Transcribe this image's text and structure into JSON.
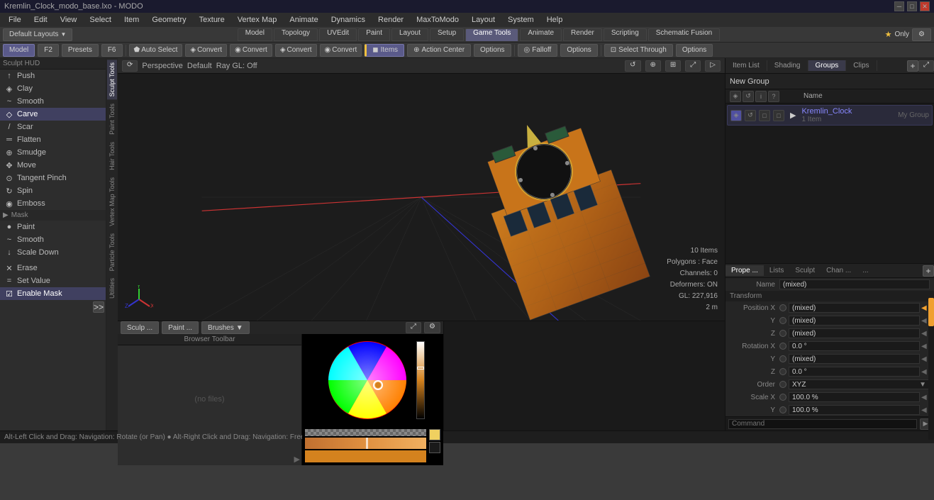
{
  "titlebar": {
    "title": "Kremlin_Clock_modo_base.lxo - MODO",
    "controls": [
      "minimize",
      "restore",
      "close"
    ]
  },
  "menubar": {
    "items": [
      "File",
      "Edit",
      "View",
      "Select",
      "Item",
      "Geometry",
      "Texture",
      "Vertex Map",
      "Animate",
      "Dynamics",
      "Render",
      "MaxToModo",
      "Layout",
      "System",
      "Help"
    ]
  },
  "toolbar1": {
    "layout_label": "Default Layouts",
    "tabs": [
      "Model",
      "Topology",
      "UVEdit",
      "Paint",
      "Layout",
      "Setup",
      "Game Tools",
      "Animate",
      "Render",
      "Scripting",
      "Schematic Fusion"
    ]
  },
  "toolbar2": {
    "mode_tabs": [
      "Model",
      "F2",
      "Presets",
      "F6"
    ],
    "auto_select": "Auto Select",
    "convert_buttons": [
      "Convert",
      "Convert",
      "Convert",
      "Convert"
    ],
    "items_btn": "Items",
    "action_center": "Action Center",
    "options1": "Options",
    "falloff": "Falloff",
    "options2": "Options",
    "select_through": "Select Through",
    "options3": "Options"
  },
  "toolbar3": {
    "perspective": "Perspective",
    "default": "Default",
    "ray_gl": "Ray GL: Off"
  },
  "sculpt_tools": {
    "section_title": "Sculpt HUD",
    "tools": [
      {
        "name": "Push",
        "icon": "↑"
      },
      {
        "name": "Clay",
        "icon": "◈"
      },
      {
        "name": "Smooth",
        "icon": "~"
      },
      {
        "name": "Carve",
        "icon": "◇"
      },
      {
        "name": "Scar",
        "icon": "/"
      },
      {
        "name": "Flatten",
        "icon": "═"
      },
      {
        "name": "Smudge",
        "icon": "⊕"
      },
      {
        "name": "Move",
        "icon": "✥"
      },
      {
        "name": "Tangent Pinch",
        "icon": "⊙"
      },
      {
        "name": "Spin",
        "icon": "↻"
      },
      {
        "name": "Emboss",
        "icon": "◉"
      }
    ],
    "mask_label": "Mask",
    "mask_tools": [
      {
        "name": "Paint",
        "icon": "●"
      },
      {
        "name": "Smooth",
        "icon": "~"
      },
      {
        "name": "Scale Down",
        "icon": "↓"
      }
    ],
    "bottom_tools": [
      {
        "name": "Erase",
        "icon": "✕"
      },
      {
        "name": "Set Value",
        "icon": "="
      },
      {
        "name": "Enable Mask",
        "icon": "☑",
        "active": true
      }
    ]
  },
  "vertical_tabs": {
    "items": [
      "Sculpt Tools",
      "Paint Tools",
      "Hair Tools",
      "Vertex Map Tools",
      "Particle Tools",
      "Utilities"
    ]
  },
  "viewport": {
    "perspective": "Perspective",
    "default_label": "Default",
    "ray_gl": "Ray GL: Off",
    "hud": {
      "items_count": "10 Items",
      "polygons": "Polygons : Face",
      "channels": "Channels: 0",
      "deformers": "Deformers: ON",
      "gl": "GL: 227,916",
      "distance": "2 m"
    }
  },
  "bottom_panels": {
    "left": {
      "tabs": [
        "Sculp ...",
        "Paint ...",
        "Brushes"
      ],
      "browser_toolbar": "Browser Toolbar",
      "no_files": "(no files)"
    }
  },
  "right_panel": {
    "tabs": [
      "Item List",
      "Shading",
      "Groups",
      "Clips"
    ],
    "active_tab": "Groups",
    "new_group": "New Group",
    "columns": [
      "Name"
    ],
    "group_item": {
      "name": "Kremlin_Clock",
      "sub": "1 Item",
      "tag": "My Group"
    }
  },
  "properties_panel": {
    "tabs": [
      "Prope ...",
      "Lists",
      "Sculpt",
      "Chan ...",
      "..."
    ],
    "name_label": "Name",
    "name_value": "(mixed)",
    "transform_label": "Transform",
    "position_x_label": "Position X",
    "position_x_value": "(mixed)",
    "position_y_label": "Y",
    "position_y_value": "(mixed)",
    "position_z_label": "Z",
    "position_z_value": "(mixed)",
    "rotation_x_label": "Rotation X",
    "rotation_x_value": "0.0 °",
    "rotation_y_label": "Y",
    "rotation_y_value": "(mixed)",
    "rotation_z_label": "Z",
    "rotation_z_value": "0.0 °",
    "order_label": "Order",
    "order_value": "XYZ",
    "scale_x_label": "Scale X",
    "scale_x_value": "100.0 %",
    "scale_y_label": "Y",
    "scale_y_value": "100.0 %"
  },
  "statusbar": {
    "text": "Alt-Left Click and Drag: Navigation: Rotate (or Pan)  ●  Alt-Right Click and Drag: Navigation: Freewheel  ●  Alt-Middle Click and Drag: navRoll"
  },
  "command_bar": {
    "placeholder": "Command"
  }
}
